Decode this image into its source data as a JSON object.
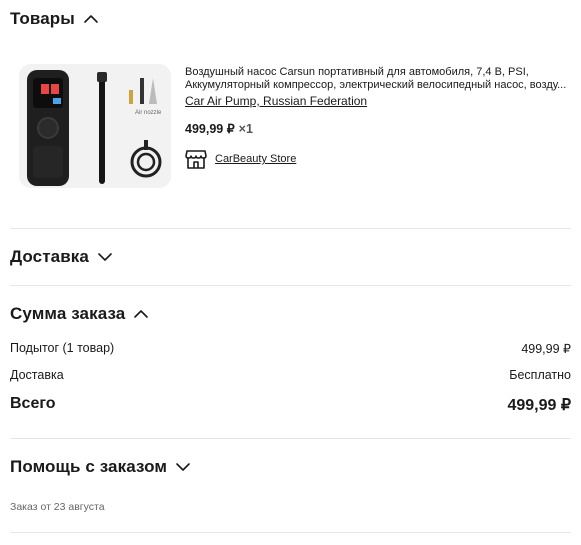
{
  "goods": {
    "title": "Товары",
    "product": {
      "description_line1": "Воздушный насос Carsun портативный для автомобиля, 7,4 В, PSI,",
      "description_line2": "Аккумуляторный компрессор, электрический велосипедный насос, возду...",
      "variant": "Car Air Pump, Russian Federation",
      "price": "499,99 ₽",
      "quantity": "×1",
      "image_label": "Air nozzle"
    },
    "store": {
      "name": "CarBeauty Store",
      "icon": "store-icon"
    }
  },
  "delivery": {
    "title": "Доставка"
  },
  "order_sum": {
    "title": "Сумма заказа",
    "subtotal_label": "Подытог (1 товар)",
    "subtotal_value": "499,99 ₽",
    "delivery_label": "Доставка",
    "delivery_value": "Бесплатно",
    "total_label": "Всего",
    "total_value": "499,99 ₽"
  },
  "help": {
    "title": "Помощь с заказом",
    "order_date": "Заказ от 23 августа"
  }
}
